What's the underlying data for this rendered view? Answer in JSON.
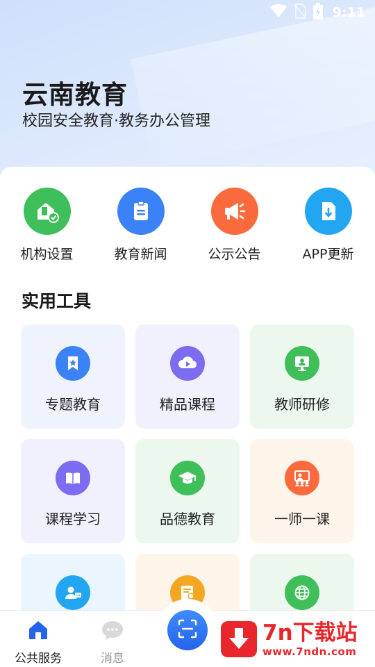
{
  "status_bar": {
    "time": "9:11"
  },
  "header": {
    "title": "云南教育",
    "subtitle": "校园安全教育·教务办公管理"
  },
  "quick_actions": [
    {
      "label": "机构设置",
      "icon": "institution-settings-icon",
      "color": "#3fbf5a"
    },
    {
      "label": "教育新闻",
      "icon": "news-document-icon",
      "color": "#3b82f6"
    },
    {
      "label": "公示公告",
      "icon": "megaphone-icon",
      "color": "#fb6a3c"
    },
    {
      "label": "APP更新",
      "icon": "download-file-icon",
      "color": "#23a6f2"
    }
  ],
  "tools_section": {
    "title": "实用工具",
    "tiles": [
      {
        "label": "专题教育",
        "icon": "star-bookmark-icon",
        "color": "#3b82f6",
        "bg": "#eef3fd"
      },
      {
        "label": "精品课程",
        "icon": "cloud-play-icon",
        "color": "#7c6cf0",
        "bg": "#f1f0fd"
      },
      {
        "label": "教师研修",
        "icon": "teacher-screen-icon",
        "color": "#3fbf5a",
        "bg": "#ecf7ee"
      },
      {
        "label": "课程学习",
        "icon": "open-book-icon",
        "color": "#7c6cf0",
        "bg": "#f1f0fd"
      },
      {
        "label": "品德教育",
        "icon": "graduation-cap-icon",
        "color": "#3fbf5a",
        "bg": "#ecf7ee"
      },
      {
        "label": "一师一课",
        "icon": "lecture-icon",
        "color": "#fb6a3c",
        "bg": "#fef5ea"
      },
      {
        "label": "",
        "icon": "user-chat-icon",
        "color": "#23a6f2",
        "bg": "#eaf5fd"
      },
      {
        "label": "",
        "icon": "certificate-icon",
        "color": "#f5a623",
        "bg": "#fef5ea"
      },
      {
        "label": "",
        "icon": "globe-icon",
        "color": "#3fbf5a",
        "bg": "#ecf7ee"
      }
    ]
  },
  "bottom_nav": {
    "items": [
      {
        "label": "公共服务",
        "icon": "home-icon",
        "active": true
      },
      {
        "label": "消息",
        "icon": "message-bubble-icon",
        "active": false
      }
    ],
    "scan_icon": "scan-icon",
    "active_color": "#2563eb",
    "inactive_color": "#9a9a9a"
  },
  "watermark": {
    "title": "7n下载站",
    "url": "www.7ndn.com"
  }
}
